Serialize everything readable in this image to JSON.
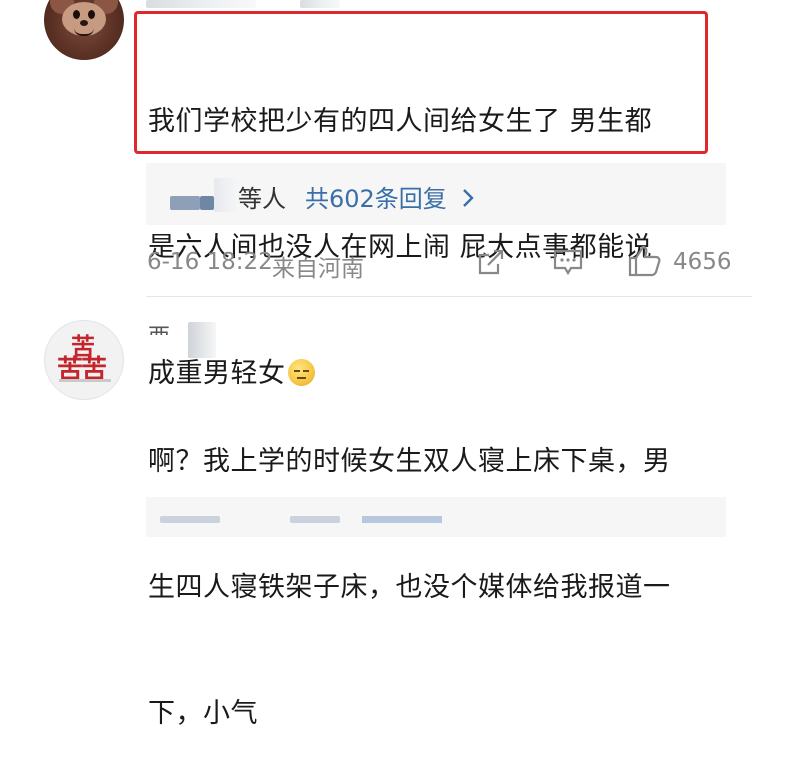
{
  "comments": [
    {
      "text_lines": [
        "我们学校把少有的四人间给女生了 男生都",
        "是六人间也没人在网上闹 屁大点事都能说",
        "成重男轻女"
      ],
      "emoji": "smirk-emoji",
      "replies": {
        "prefix": "等人",
        "count_label": "共602条回复",
        "chevron": "›"
      },
      "meta": {
        "time": "6-16 18:22",
        "location": "来自河南",
        "likes": "4656"
      },
      "highlight_color": "#e0272c"
    },
    {
      "username_partial": "西吉k",
      "avatar_text": [
        "苦",
        "苦苦"
      ],
      "text_lines": [
        "啊？我上学的时候女生双人寝上床下桌，男",
        "生四人寝铁架子床，也没个媒体给我报道一",
        "下，小气"
      ]
    }
  ],
  "colors": {
    "link": "#3a6ea8",
    "meta": "#888888",
    "reply_bg": "#f6f6f6",
    "avatar_brand": "#c4242b"
  },
  "icons": [
    "share-icon",
    "comment-icon",
    "like-icon"
  ]
}
